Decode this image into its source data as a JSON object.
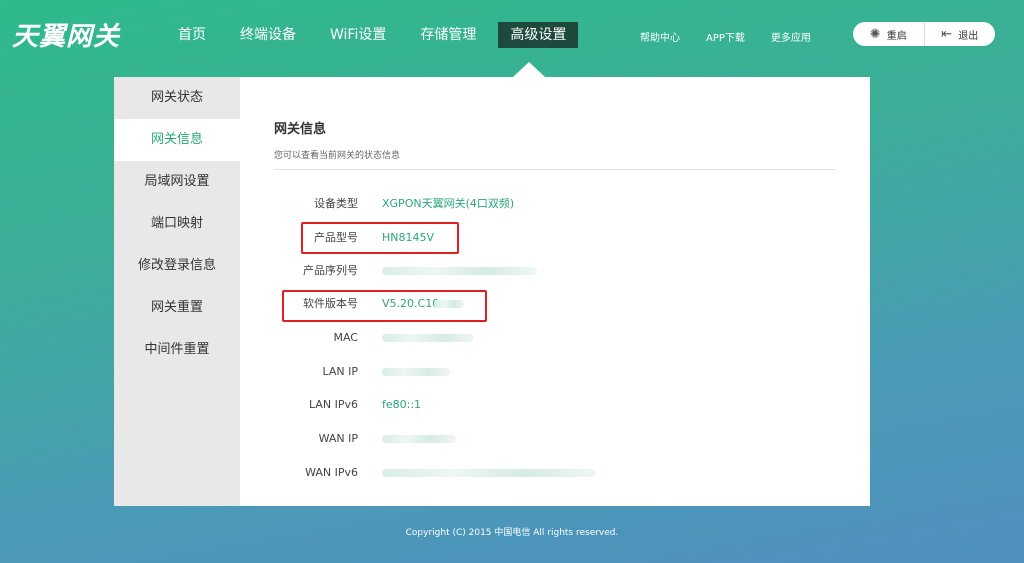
{
  "brand": {
    "logo_text": "天翼网关"
  },
  "nav": {
    "items": [
      {
        "label": "首页"
      },
      {
        "label": "终端设备"
      },
      {
        "label": "WiFi设置"
      },
      {
        "label": "存储管理"
      },
      {
        "label": "高级设置"
      }
    ],
    "active": "高级设置"
  },
  "top_links": {
    "help": "帮助中心",
    "app_download": "APP下载",
    "more_apps": "更多应用"
  },
  "system": {
    "restart_label": "重启",
    "logout_label": "退出"
  },
  "sidebar": {
    "items": [
      {
        "label": "网关状态"
      },
      {
        "label": "网关信息"
      },
      {
        "label": "局域网设置"
      },
      {
        "label": "端口映射"
      },
      {
        "label": "修改登录信息"
      },
      {
        "label": "网关重置"
      },
      {
        "label": "中间件重置"
      }
    ],
    "active": "网关信息"
  },
  "content": {
    "title": "网关信息",
    "subtitle": "您可以查看当前网关的状态信息",
    "rows": [
      {
        "label": "设备类型",
        "value": "XGPON天翼网关(4口双频)"
      },
      {
        "label": "产品型号",
        "value": "HN8145V"
      },
      {
        "label": "产品序列号",
        "value": ""
      },
      {
        "label": "软件版本号",
        "value": "V5.20.C10"
      },
      {
        "label": "MAC",
        "value": ""
      },
      {
        "label": "LAN IP",
        "value": ""
      },
      {
        "label": "LAN IPv6",
        "value": "fe80::1"
      },
      {
        "label": "WAN IP",
        "value": ""
      },
      {
        "label": "WAN IPv6",
        "value": ""
      }
    ]
  },
  "footer": {
    "copyright": "Copyright (C) 2015 中国电信 All rights reserved."
  },
  "colors": {
    "accent": "#26a876",
    "highlight_box": "#e02020",
    "nav_active_bg": "#1d4a3c"
  }
}
